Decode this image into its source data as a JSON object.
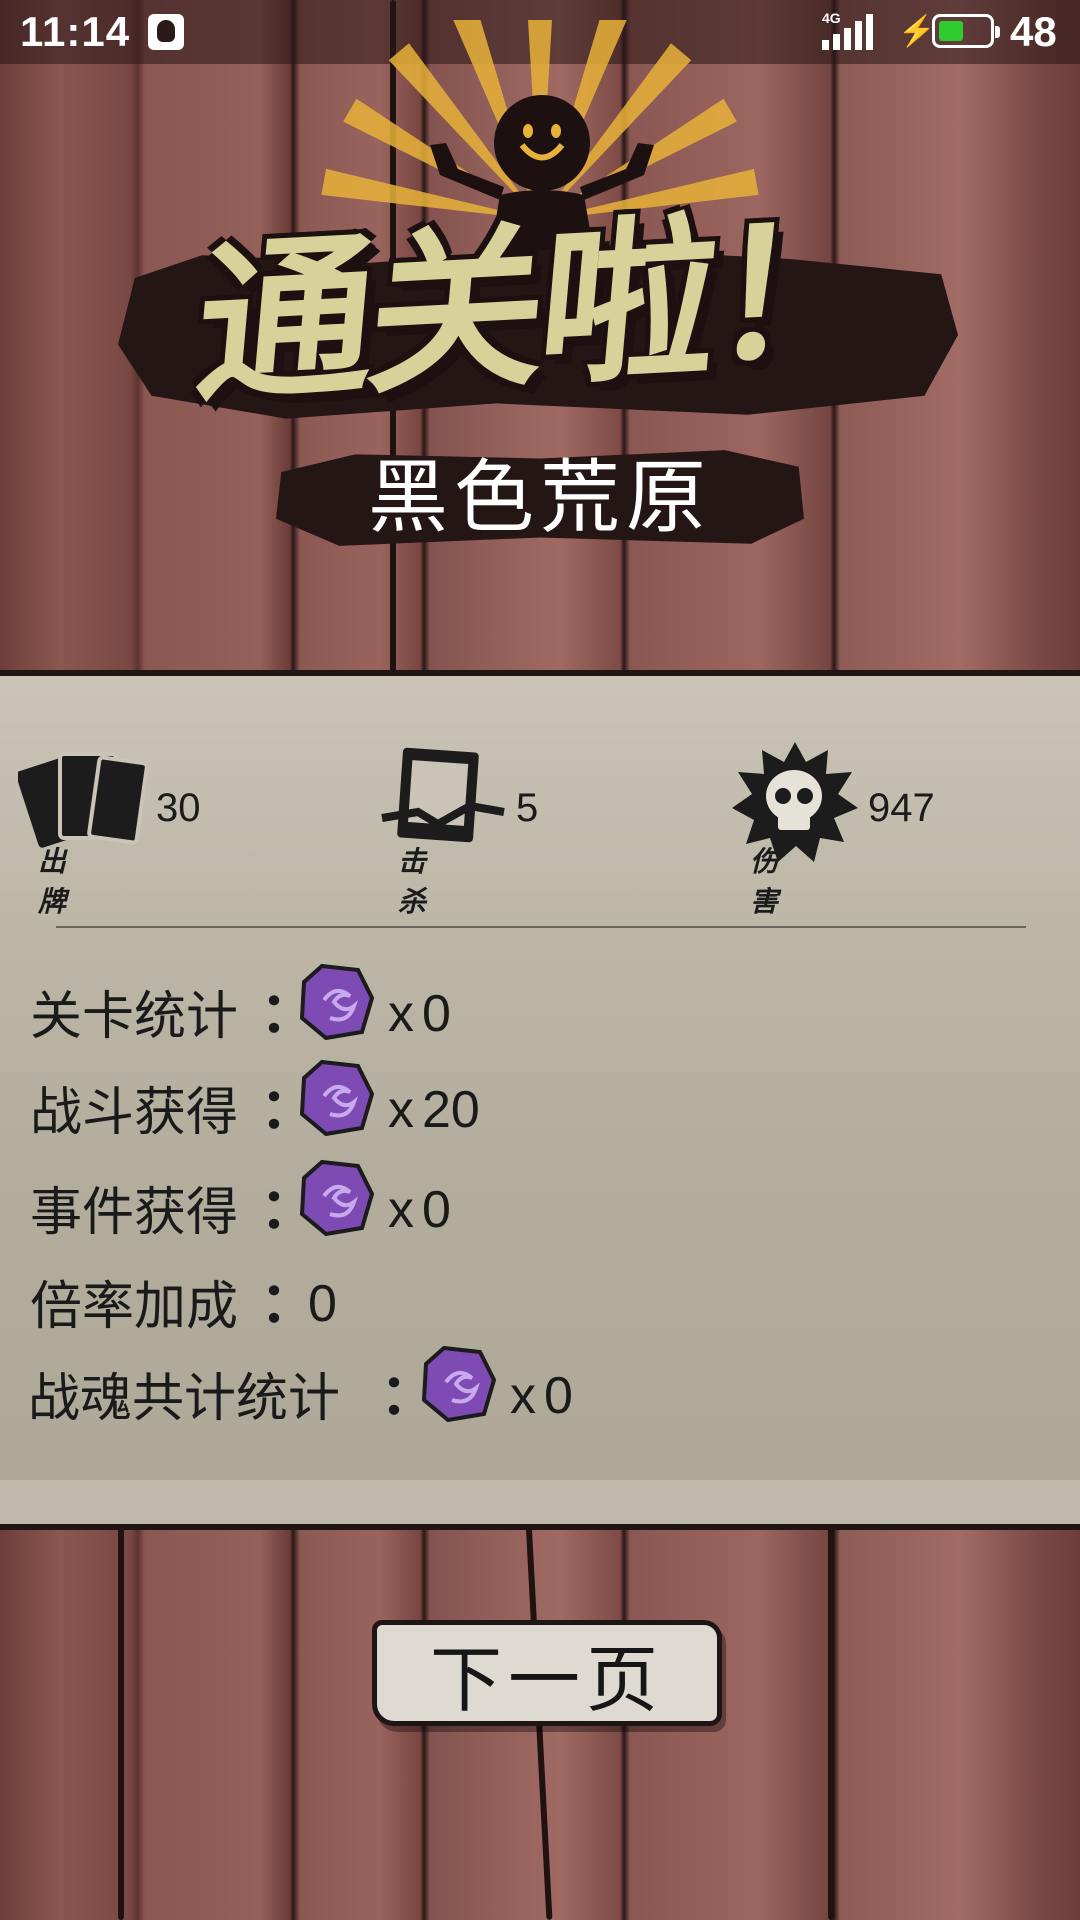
{
  "status_bar": {
    "time": "11:14",
    "network": "4G",
    "battery_level": "48",
    "battery_fraction": 0.48,
    "battery_color": "#2ecc2e",
    "icons": [
      "qq-icon",
      "signal-icon",
      "charging-icon",
      "battery-icon"
    ]
  },
  "header": {
    "title": "通关啦！",
    "subtitle": "黑色荒原",
    "title_color": "#d7d29a",
    "ray_color": "#e8b23a"
  },
  "stats": [
    {
      "caption": "出牌",
      "value": "30",
      "icon": "cards-icon"
    },
    {
      "caption": "击杀",
      "value": "5",
      "icon": "kill-icon"
    },
    {
      "caption": "伤害",
      "value": "947",
      "icon": "skull-icon"
    }
  ],
  "rewards": [
    {
      "label": "关卡统计",
      "colon": "：",
      "multiplier": "x",
      "value": "0",
      "has_gem": true
    },
    {
      "label": "战斗获得",
      "colon": "：",
      "multiplier": "x",
      "value": "20",
      "has_gem": true
    },
    {
      "label": "事件获得",
      "colon": "：",
      "multiplier": "x",
      "value": "0",
      "has_gem": true
    },
    {
      "label": "倍率加成",
      "colon": "：",
      "multiplier": "",
      "value": "0",
      "has_gem": false
    },
    {
      "label": "战魂共计统计",
      "colon": "：",
      "multiplier": "x",
      "value": "0",
      "has_gem": true
    }
  ],
  "gem_color": "#7d4bb3",
  "next_button": {
    "label": "下一页"
  }
}
